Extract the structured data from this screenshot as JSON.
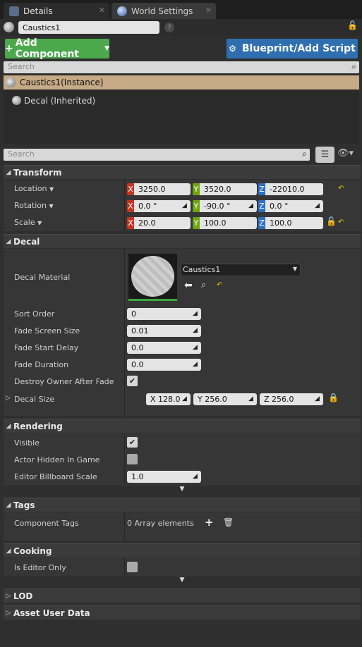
{
  "tabs": [
    {
      "label": "Details"
    },
    {
      "label": "World Settings"
    }
  ],
  "actor_name": "Caustics1",
  "buttons": {
    "add_component": "Add Component",
    "blueprint": "Blueprint/Add Script"
  },
  "component_search": {
    "placeholder": "Search"
  },
  "components": [
    {
      "label": "Caustics1(Instance)"
    },
    {
      "label": "Decal (Inherited)"
    }
  ],
  "details_search": {
    "placeholder": "Search"
  },
  "transform": {
    "title": "Transform",
    "location": {
      "label": "Location",
      "x": "3250.0",
      "y": "3520.0",
      "z": "-22010.0"
    },
    "rotation": {
      "label": "Rotation",
      "x": "0.0 °",
      "y": "-90.0 °",
      "z": "0.0 °"
    },
    "scale": {
      "label": "Scale",
      "x": "20.0",
      "y": "100.0",
      "z": "100.0"
    }
  },
  "decal": {
    "title": "Decal",
    "material_label": "Decal Material",
    "material_value": "Caustics1",
    "sort_order": {
      "label": "Sort Order",
      "value": "0"
    },
    "fade_screen_size": {
      "label": "Fade Screen Size",
      "value": "0.01"
    },
    "fade_start_delay": {
      "label": "Fade Start Delay",
      "value": "0.0"
    },
    "fade_duration": {
      "label": "Fade Duration",
      "value": "0.0"
    },
    "destroy_owner": {
      "label": "Destroy Owner After Fade",
      "checked": true
    },
    "decal_size": {
      "label": "Decal Size",
      "x": "128.0",
      "y": "256.0",
      "z": "256.0"
    }
  },
  "rendering": {
    "title": "Rendering",
    "visible": {
      "label": "Visible",
      "checked": true
    },
    "actor_hidden": {
      "label": "Actor Hidden In Game",
      "checked": false
    },
    "billboard_scale": {
      "label": "Editor Billboard Scale",
      "value": "1.0"
    }
  },
  "tags": {
    "title": "Tags",
    "component_tags": {
      "label": "Component Tags",
      "value": "0 Array elements"
    }
  },
  "cooking": {
    "title": "Cooking",
    "editor_only": {
      "label": "Is Editor Only",
      "checked": false
    }
  },
  "lod": {
    "title": "LOD"
  },
  "asset_user_data": {
    "title": "Asset User Data"
  },
  "axis_letters": {
    "x": "X",
    "y": "Y",
    "z": "Z"
  },
  "colors": {
    "add_button": "#4ba94b",
    "blueprint_button": "#2f6fb0",
    "selected_component": "#c6a986"
  }
}
